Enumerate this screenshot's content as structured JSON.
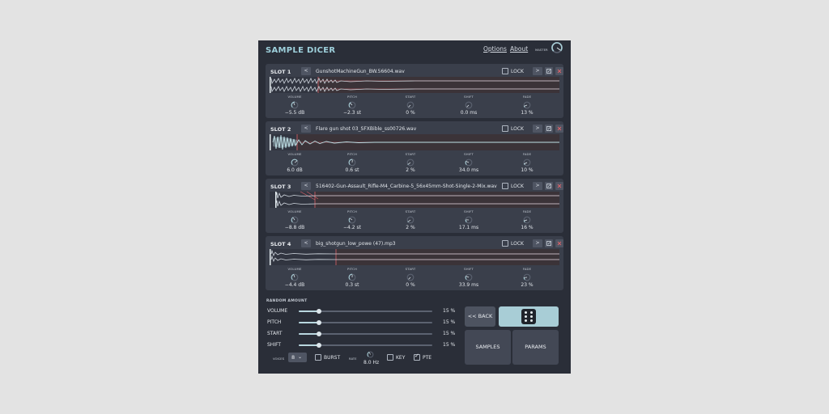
{
  "app": {
    "title": "SAMPLE DICER",
    "options_label": "Options",
    "about_label": "About",
    "master_label": "MASTER"
  },
  "slots": [
    {
      "label": "SLOT 1",
      "filename": "GunshotMachineGun_BW.56604.wav",
      "lock_label": "LOCK",
      "params": [
        {
          "name": "VOLUME",
          "value": "−5.5 dB"
        },
        {
          "name": "PITCH",
          "value": "−2.3 st"
        },
        {
          "name": "START",
          "value": "0 %"
        },
        {
          "name": "SHIFT",
          "value": "0.0 ms"
        },
        {
          "name": "FADE",
          "value": "13 %"
        }
      ]
    },
    {
      "label": "SLOT 2",
      "filename": "Flare gun shot 03_SFXBible_ss00726.wav",
      "lock_label": "LOCK",
      "params": [
        {
          "name": "VOLUME",
          "value": "6.0 dB"
        },
        {
          "name": "PITCH",
          "value": "0.6 st"
        },
        {
          "name": "START",
          "value": "2 %"
        },
        {
          "name": "SHIFT",
          "value": "34.0 ms"
        },
        {
          "name": "FADE",
          "value": "10 %"
        }
      ]
    },
    {
      "label": "SLOT 3",
      "filename": "516402-Gun-Assault_Rifle-M4_Carbine-5_56x45mm-Shot-Single-2-Mix.wav",
      "lock_label": "LOCK",
      "params": [
        {
          "name": "VOLUME",
          "value": "−8.8 dB"
        },
        {
          "name": "PITCH",
          "value": "−4.2 st"
        },
        {
          "name": "START",
          "value": "2 %"
        },
        {
          "name": "SHIFT",
          "value": "17.1 ms"
        },
        {
          "name": "FADE",
          "value": "16 %"
        }
      ]
    },
    {
      "label": "SLOT 4",
      "filename": "big_shotgun_low_powe (47).mp3",
      "lock_label": "LOCK",
      "params": [
        {
          "name": "VOLUME",
          "value": "−4.4 dB"
        },
        {
          "name": "PITCH",
          "value": "0.3 st"
        },
        {
          "name": "START",
          "value": "0 %"
        },
        {
          "name": "SHIFT",
          "value": "33.9 ms"
        },
        {
          "name": "FADE",
          "value": "23 %"
        }
      ]
    }
  ],
  "random": {
    "title": "RANDOM AMOUNT",
    "rows": [
      {
        "label": "VOLUME",
        "value": "15 %",
        "fraction": 0.15
      },
      {
        "label": "PITCH",
        "value": "15 %",
        "fraction": 0.15
      },
      {
        "label": "START",
        "value": "15 %",
        "fraction": 0.15
      },
      {
        "label": "SHIFT",
        "value": "15 %",
        "fraction": 0.15
      }
    ]
  },
  "bottom": {
    "voices_label": "VOICES",
    "voices_value": "8",
    "burst_label": "BURST",
    "burst_checked": false,
    "rate_label": "RATE",
    "rate_value": "8.0 Hz",
    "key_label": "KEY",
    "key_checked": false,
    "pte_label": "PTE",
    "pte_checked": true
  },
  "buttons": {
    "back_label": "<< BACK",
    "samples_label": "SAMPLES",
    "params_label": "PARAMS"
  },
  "colors": {
    "background": "#e3e3e3",
    "panel": "#2a2e38",
    "slot": "#3a3f4b",
    "accent": "#a8cdd6",
    "title": "#9ed0dc",
    "marker": "#d9636a"
  }
}
